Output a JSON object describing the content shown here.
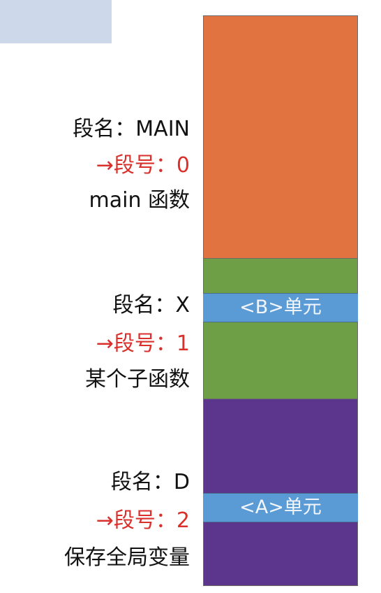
{
  "colors": {
    "main": "#e07340",
    "x": "#6e9e46",
    "d": "#5c368c",
    "unit": "#5b9bd5",
    "accent": "#d9302c"
  },
  "segments": [
    {
      "name": "段名：MAIN",
      "number": "→段号：0",
      "desc": "main 函数"
    },
    {
      "name": "段名：X",
      "number": "→段号：1",
      "desc": "某个子函数",
      "unit": "<B>单元"
    },
    {
      "name": "段名：D",
      "number": "→段号：2",
      "desc": "保存全局变量",
      "unit": "<A>单元"
    }
  ]
}
